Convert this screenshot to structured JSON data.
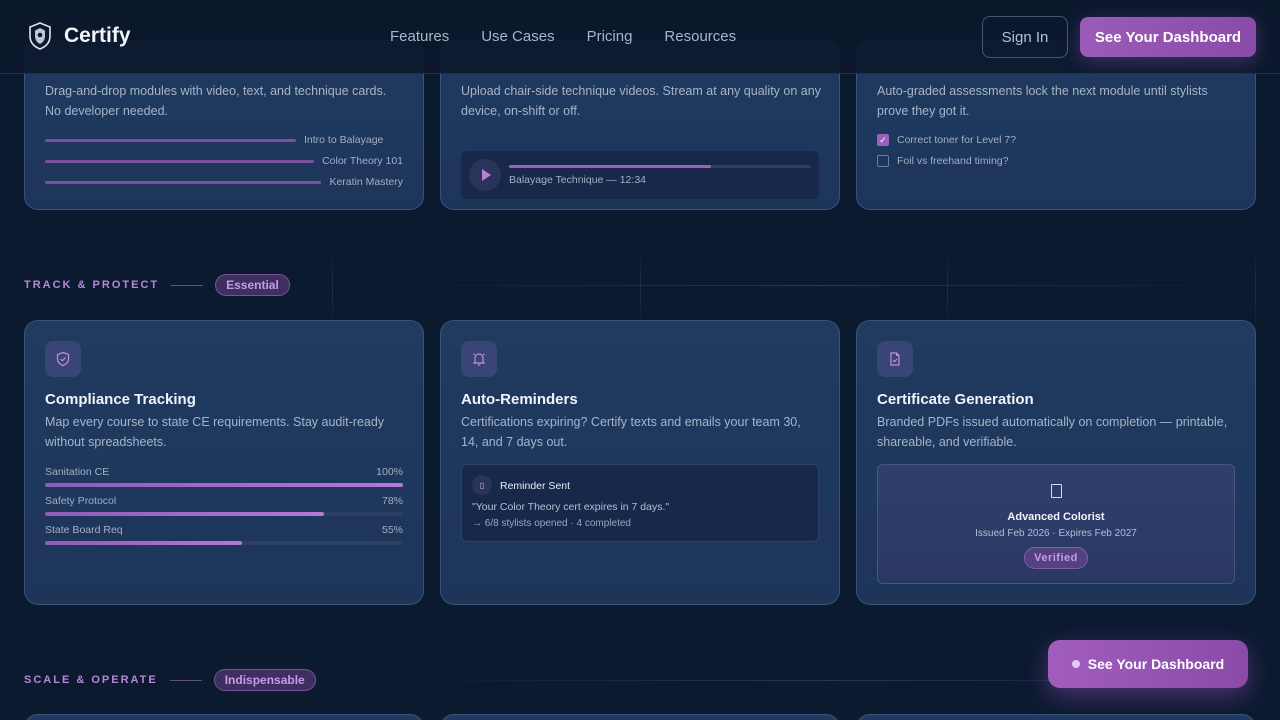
{
  "header": {
    "brand": "Certify",
    "nav": [
      "Features",
      "Use Cases",
      "Pricing",
      "Resources"
    ],
    "sign_in": "Sign In",
    "cta": "See Your Dashboard"
  },
  "top_cards": [
    {
      "desc": "Drag-and-drop modules with video, text, and technique cards. No developer needed.",
      "modules": [
        {
          "label": "Intro to Balayage"
        },
        {
          "label": "Color Theory 101"
        },
        {
          "label": "Keratin Mastery"
        }
      ]
    },
    {
      "desc": "Upload chair-side technique videos. Stream at any quality on any device, on-shift or off.",
      "video_label": "Balayage Technique — 12:34",
      "video_progress": 0.67
    },
    {
      "desc": "Auto-graded assessments lock the next module until stylists prove they got it.",
      "checks": [
        {
          "label": "Correct toner for Level 7?",
          "checked": true
        },
        {
          "label": "Foil vs freehand timing?",
          "checked": false
        }
      ]
    }
  ],
  "section_track": {
    "label": "TRACK & PROTECT",
    "pill": "Essential"
  },
  "compliance": {
    "title": "Compliance Tracking",
    "desc": "Map every course to state CE requirements. Stay audit-ready without spreadsheets.",
    "rows": [
      {
        "label": "Sanitation CE",
        "pct_text": "100%",
        "value": 1.0
      },
      {
        "label": "Safety Protocol",
        "pct_text": "78%",
        "value": 0.78
      },
      {
        "label": "State Board Req",
        "pct_text": "55%",
        "value": 0.55
      }
    ]
  },
  "reminders": {
    "title": "Auto-Reminders",
    "desc": "Certifications expiring? Certify texts and emails your team 30, 14, and 7 days out.",
    "box_title": "Reminder Sent",
    "message": "\"Your Color Theory cert expires in 7 days.\"",
    "stat": "→ 6/8 stylists opened · 4 completed"
  },
  "certificate": {
    "title": "Certificate Generation",
    "desc": "Branded PDFs issued automatically on completion — printable, shareable, and verifiable.",
    "cert_name": "Advanced Colorist",
    "cert_dates": "Issued Feb 2026 · Expires Feb 2027",
    "badge": "Verified"
  },
  "section_scale": {
    "label": "SCALE & OPERATE",
    "pill": "Indispensable"
  },
  "fab": {
    "label": "See Your Dashboard"
  }
}
